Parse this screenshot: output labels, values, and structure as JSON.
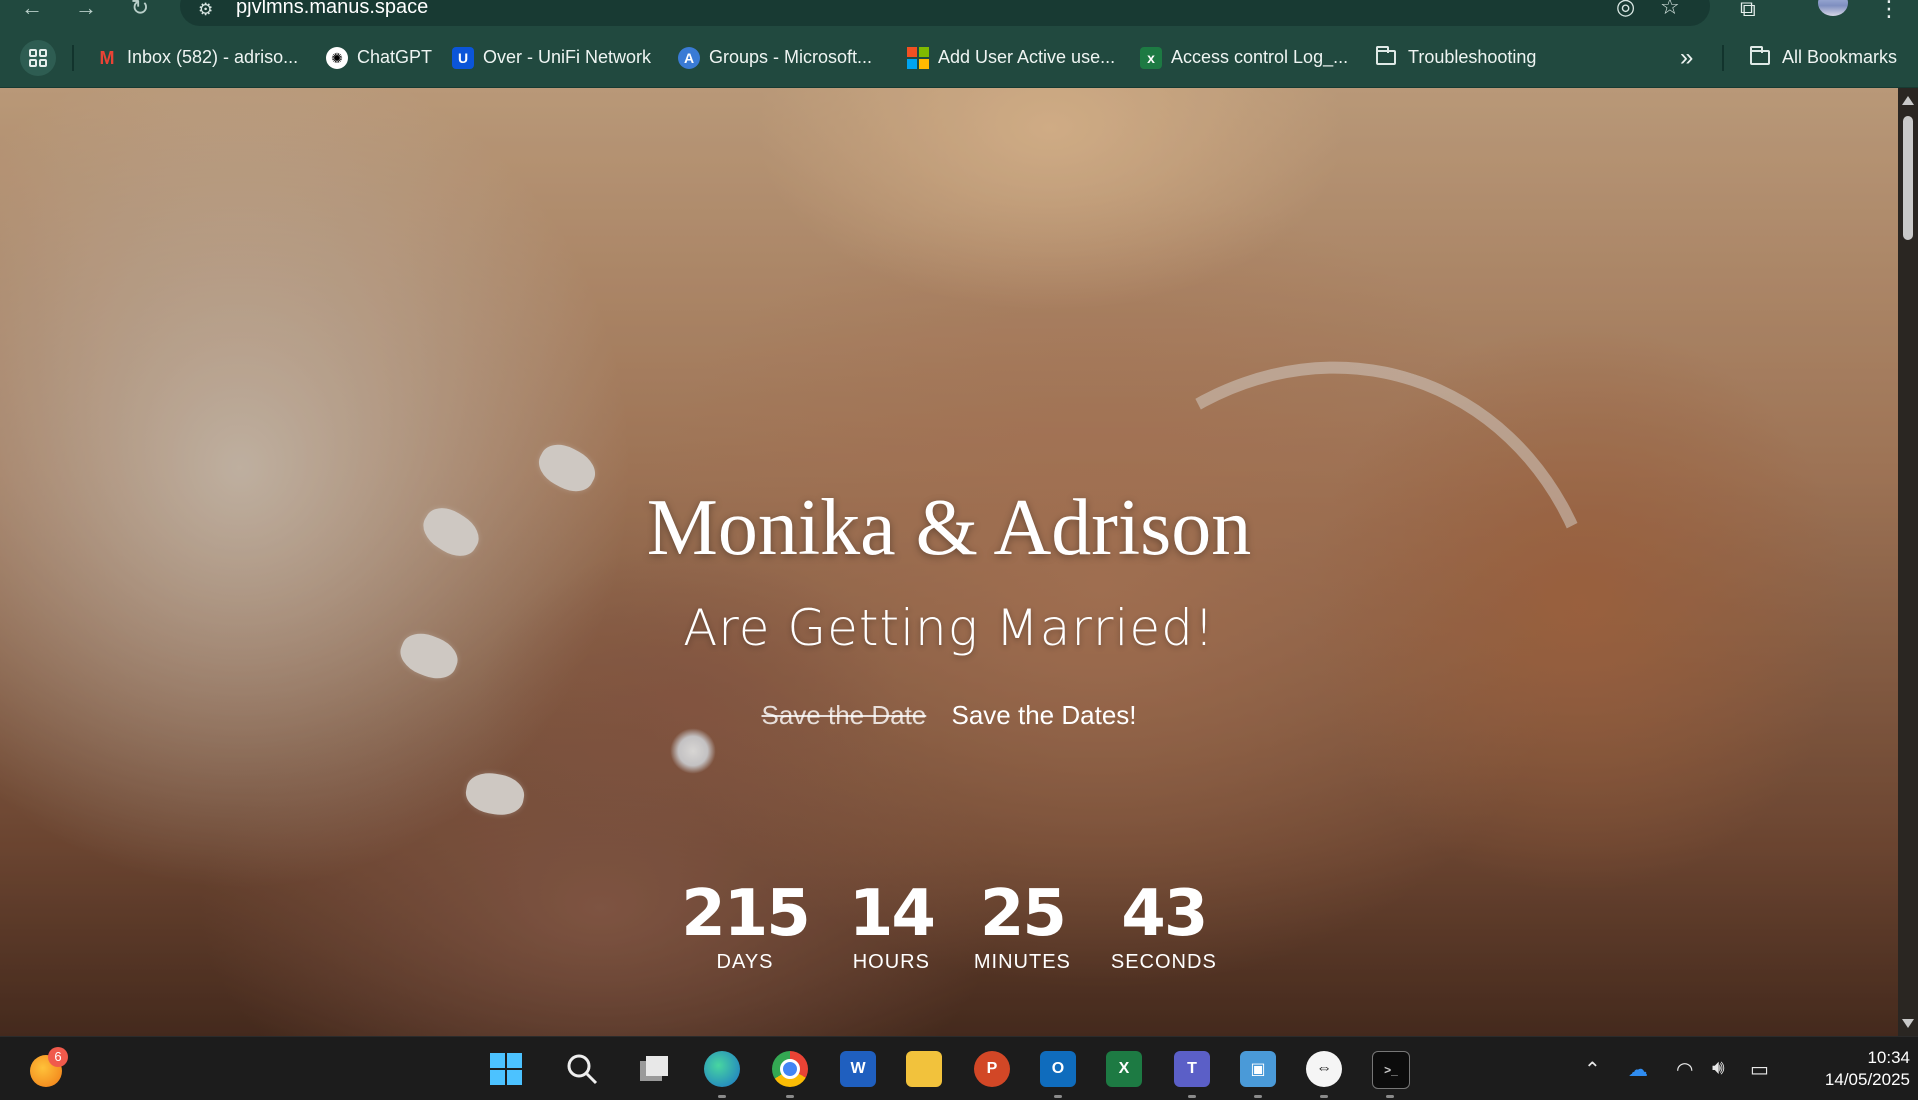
{
  "browser": {
    "url": "pjvlmns.manus.space",
    "bookmarks": [
      {
        "label": "Inbox (582) - adriso...",
        "icon": "gmail-icon"
      },
      {
        "label": "ChatGPT",
        "icon": "chatgpt-icon"
      },
      {
        "label": "Over - UniFi Network",
        "icon": "unifi-icon"
      },
      {
        "label": "Groups - Microsoft...",
        "icon": "azure-icon"
      },
      {
        "label": "Add User Active use...",
        "icon": "microsoft-icon"
      },
      {
        "label": "Access control Log_...",
        "icon": "excel-icon"
      },
      {
        "label": "Troubleshooting",
        "icon": "folder-icon"
      }
    ],
    "overflow_label": "»",
    "all_bookmarks_label": "All Bookmarks"
  },
  "hero": {
    "names": "Monika & Adrison",
    "subtitle": "Are Getting Married!",
    "save_old": "Save the Date",
    "save_new": "Save the Dates!"
  },
  "countdown": {
    "days": "215",
    "days_label": "DAYS",
    "hours": "14",
    "hours_label": "HOURS",
    "minutes": "25",
    "minutes_label": "MINUTES",
    "seconds": "43",
    "seconds_label": "SECONDS"
  },
  "taskbar": {
    "widget_badge": "6",
    "time": "10:34",
    "date": "14/05/2025"
  }
}
